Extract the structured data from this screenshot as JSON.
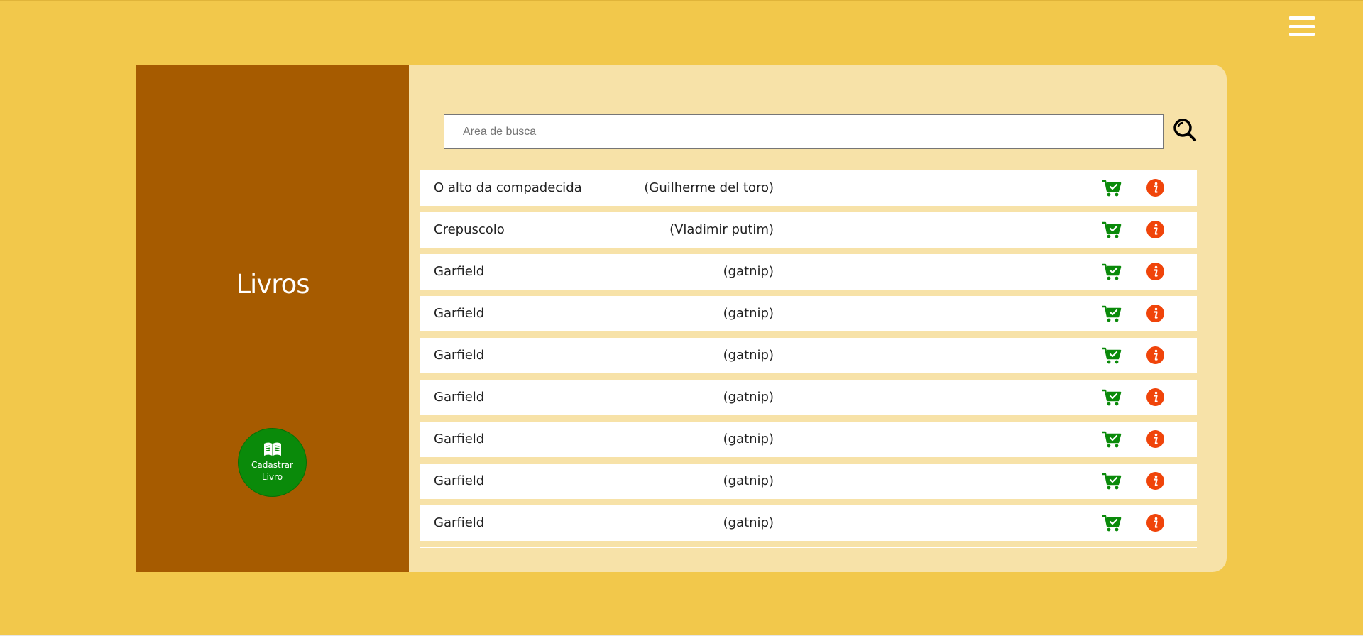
{
  "colors": {
    "background": "#f2c84b",
    "sidebar": "#a65b00",
    "panel": "#f7e2a8",
    "register_button": "#0a8a0a",
    "cart_icon": "#0a8a0a",
    "info_icon": "#f0440a"
  },
  "header": {
    "menu_icon": "hamburger-icon"
  },
  "sidebar": {
    "title": "Livros",
    "register_button": {
      "icon": "book-open-icon",
      "label": "Cadastrar Livro"
    }
  },
  "search": {
    "placeholder": "Area de busca",
    "value": "",
    "icon": "search-icon"
  },
  "books": [
    {
      "title": "O alto da compadecida",
      "author": "(Guilherme del toro)"
    },
    {
      "title": "Crepuscolo",
      "author": "(Vladimir putim)"
    },
    {
      "title": "Garfield",
      "author": "(gatnip)"
    },
    {
      "title": "Garfield",
      "author": "(gatnip)"
    },
    {
      "title": "Garfield",
      "author": "(gatnip)"
    },
    {
      "title": "Garfield",
      "author": "(gatnip)"
    },
    {
      "title": "Garfield",
      "author": "(gatnip)"
    },
    {
      "title": "Garfield",
      "author": "(gatnip)"
    },
    {
      "title": "Garfield",
      "author": "(gatnip)"
    }
  ],
  "row_icons": {
    "cart": "cart-check-icon",
    "info": "info-icon"
  }
}
